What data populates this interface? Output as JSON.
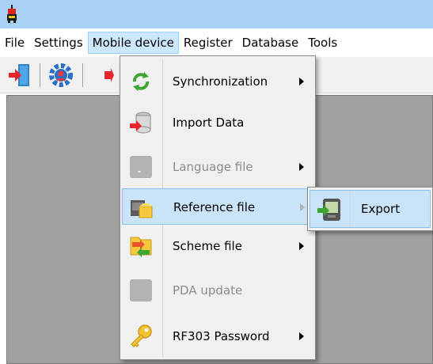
{
  "menubar": {
    "items": [
      {
        "label": "File"
      },
      {
        "label": "Settings"
      },
      {
        "label": "Mobile device"
      },
      {
        "label": "Register"
      },
      {
        "label": "Database"
      },
      {
        "label": "Tools"
      }
    ]
  },
  "toolbar": {
    "buttons": [
      "exit-door-icon",
      "settings-gear-icon",
      "import-icon"
    ]
  },
  "mobile_menu": {
    "items": [
      {
        "label": "Synchronization",
        "icon": "sync-arrows-icon",
        "submenu": true,
        "enabled": true
      },
      {
        "label": "Import Data",
        "icon": "database-import-icon",
        "submenu": false,
        "enabled": true
      },
      {
        "label": "Language file",
        "icon": "language-file-icon",
        "submenu": true,
        "enabled": false
      },
      {
        "label": "Reference file",
        "icon": "reference-file-icon",
        "submenu": true,
        "enabled": true,
        "highlighted": true
      },
      {
        "label": "Scheme file",
        "icon": "scheme-file-icon",
        "submenu": true,
        "enabled": true
      },
      {
        "label": "PDA update",
        "icon": "pda-update-icon",
        "submenu": false,
        "enabled": false
      },
      {
        "label": "RF303 Password",
        "icon": "key-icon",
        "submenu": true,
        "enabled": true
      }
    ]
  },
  "submenu": {
    "items": [
      {
        "label": "Export",
        "icon": "device-export-icon",
        "highlighted": true
      }
    ]
  },
  "colors": {
    "titlebar": "#a9d1f5",
    "menu_highlight": "#cce8ff",
    "item_highlight": "#c9e3f9",
    "workspace": "#a0a0a0",
    "disabled_text": "#8d8d8d"
  }
}
